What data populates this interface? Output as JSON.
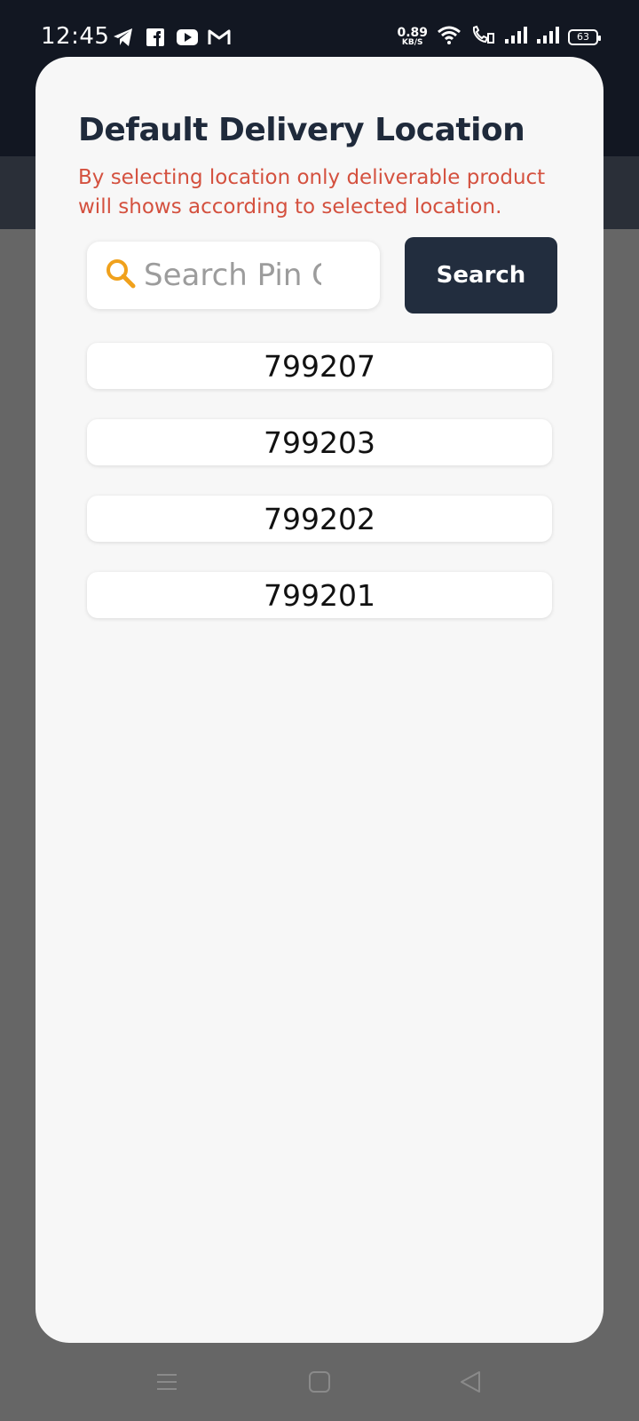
{
  "status_bar": {
    "time": "12:45",
    "net_speed_value": "0.89",
    "net_speed_unit": "KB/S",
    "battery": "63",
    "app_icons": [
      "telegram-icon",
      "facebook-icon",
      "youtube-icon",
      "gmail-icon"
    ],
    "system_icons": [
      "wifi-icon",
      "wifi-calling-icon",
      "signal-icon",
      "signal-icon"
    ]
  },
  "modal": {
    "title": "Default Delivery Location",
    "subtitle": "By selecting location only deliverable product will shows according to selected location.",
    "search": {
      "placeholder": "Search Pin Code",
      "value": "",
      "button_label": "Search"
    },
    "pincodes": [
      {
        "label": "799207"
      },
      {
        "label": "799203"
      },
      {
        "label": "799202"
      },
      {
        "label": "799201"
      }
    ]
  },
  "colors": {
    "title": "#1f2a3b",
    "subtitle": "#d4513f",
    "button_bg": "#222d3e",
    "search_icon": "#f0a11c",
    "modal_bg": "#f7f7f7",
    "overlay": "#666666"
  },
  "nav_bar": {
    "buttons": [
      "menu-icon",
      "home-icon",
      "back-icon"
    ]
  }
}
